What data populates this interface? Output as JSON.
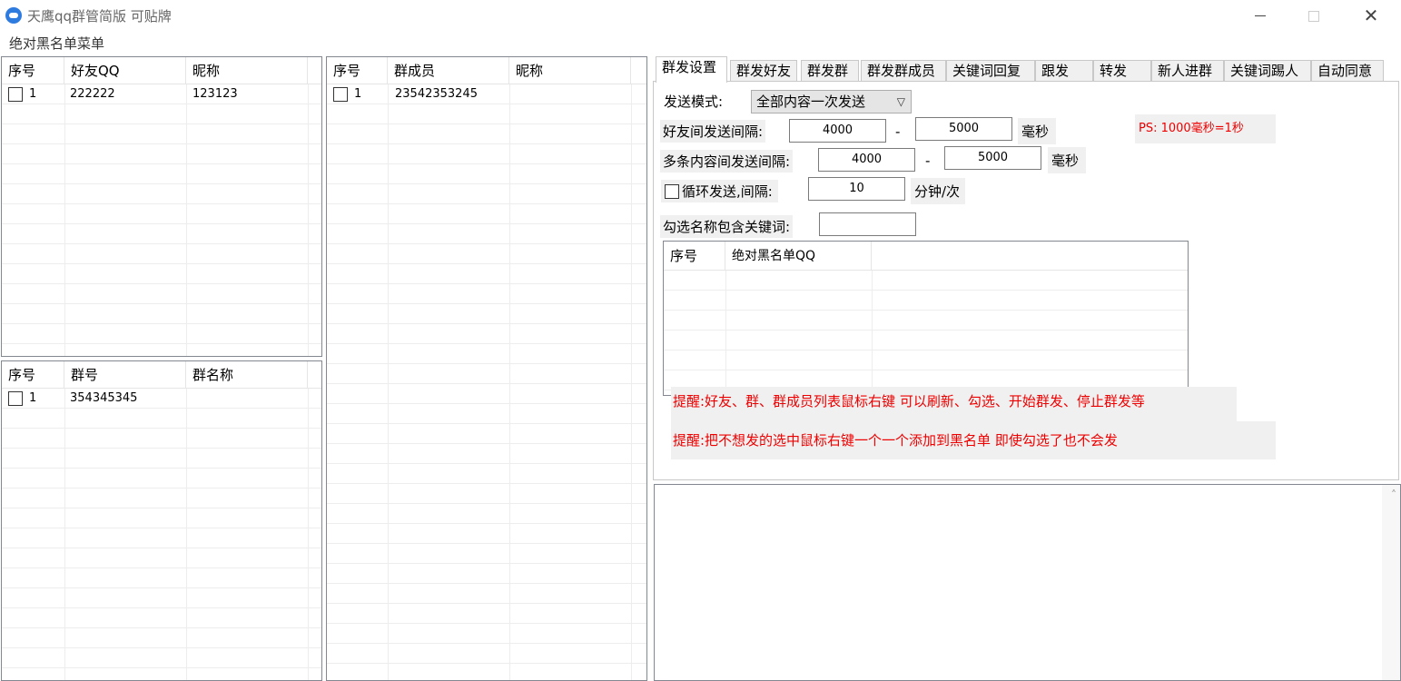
{
  "window": {
    "title": "天鹰qq群管简版 可贴牌"
  },
  "menu": {
    "items": [
      "绝对黑名单菜单"
    ]
  },
  "friends_list": {
    "headers": [
      "序号",
      "好友QQ",
      "昵称"
    ],
    "rows": [
      {
        "index": "1",
        "qq": "222222",
        "nickname": "123123"
      }
    ]
  },
  "groups_list": {
    "headers": [
      "序号",
      "群号",
      "群名称"
    ],
    "rows": [
      {
        "index": "1",
        "group_id": "354345345",
        "group_name": ""
      }
    ]
  },
  "members_list": {
    "headers": [
      "序号",
      "群成员",
      "昵称"
    ],
    "rows": [
      {
        "index": "1",
        "member": "23542353245",
        "nickname": ""
      }
    ]
  },
  "tabs": [
    "群发设置",
    "群发好友",
    "群发群",
    "群发群成员",
    "关键词回复",
    "跟发",
    "转发",
    "新人进群",
    "关键词踢人",
    "自动同意"
  ],
  "settings": {
    "send_mode_label": "发送模式:",
    "send_mode_value": "全部内容一次发送",
    "friend_interval_label": "好友间发送间隔:",
    "friend_interval_min": "4000",
    "friend_interval_max": "5000",
    "multi_interval_label": "多条内容间发送间隔:",
    "multi_interval_min": "4000",
    "multi_interval_max": "5000",
    "dash": "-",
    "ms_unit": "毫秒",
    "ps_note": "PS: 1000毫秒=1秒",
    "loop_label": "循环发送,间隔:",
    "loop_value": "10",
    "loop_unit": "分钟/次",
    "keyword_label": "勾选名称包含关键词:",
    "keyword_value": ""
  },
  "blacklist": {
    "headers": [
      "序号",
      "绝对黑名单QQ"
    ]
  },
  "tips": [
    "提醒:好友、群、群成员列表鼠标右键 可以刷新、勾选、开始群发、停止群发等",
    "提醒:把不想发的选中鼠标右键一个一个添加到黑名单 即使勾选了也不会发"
  ],
  "colors": {
    "accent_red": "#e00000",
    "app_icon": "#2e7be0"
  }
}
